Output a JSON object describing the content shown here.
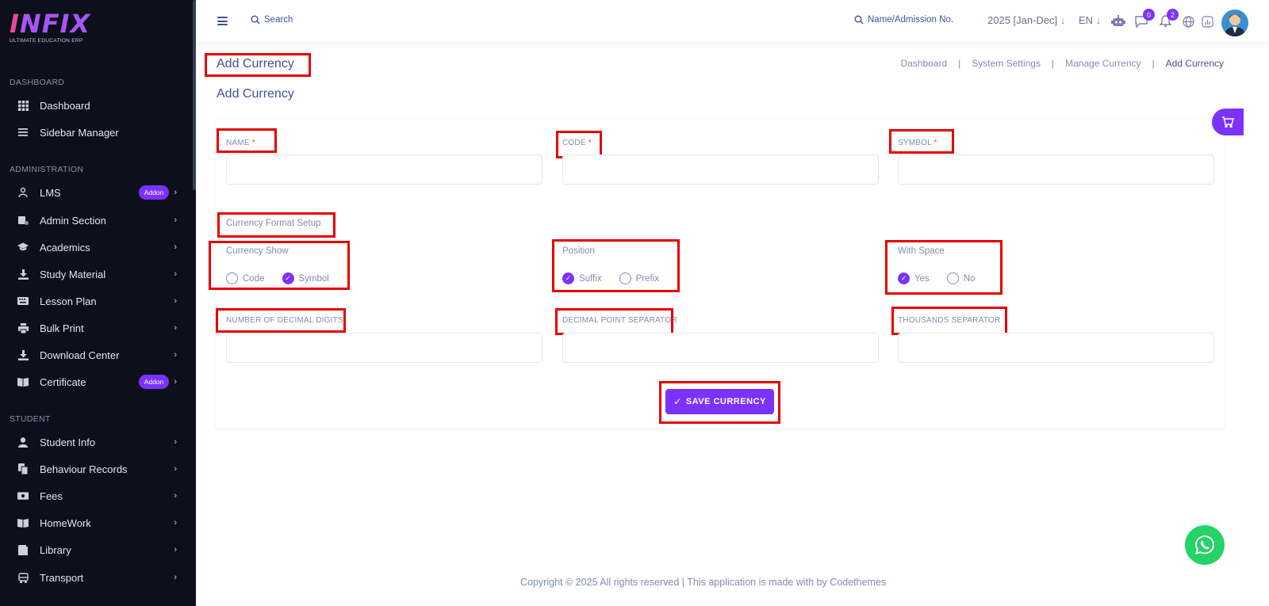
{
  "brand": {
    "logo": "INFIX",
    "tagline": "ULTIMATE EDUCATION ERP"
  },
  "sidebar": {
    "sections": [
      {
        "label": "DASHBOARD",
        "items": [
          {
            "label": "Dashboard",
            "icon": "grid-icon"
          },
          {
            "label": "Sidebar Manager",
            "icon": "list-icon"
          }
        ]
      },
      {
        "label": "ADMINISTRATION",
        "items": [
          {
            "label": "LMS",
            "icon": "lms-icon",
            "badge": "Addon"
          },
          {
            "label": "Admin Section",
            "icon": "admin-icon"
          },
          {
            "label": "Academics",
            "icon": "graduation-cap-icon"
          },
          {
            "label": "Study Material",
            "icon": "download-icon"
          },
          {
            "label": "Lesson Plan",
            "icon": "keyboard-icon"
          },
          {
            "label": "Bulk Print",
            "icon": "printer-icon"
          },
          {
            "label": "Download Center",
            "icon": "download-icon"
          },
          {
            "label": "Certificate",
            "icon": "book-icon",
            "badge": "Addon"
          }
        ]
      },
      {
        "label": "STUDENT",
        "items": [
          {
            "label": "Student Info",
            "icon": "user-icon"
          },
          {
            "label": "Behaviour Records",
            "icon": "records-icon"
          },
          {
            "label": "Fees",
            "icon": "money-icon"
          },
          {
            "label": "HomeWork",
            "icon": "book-icon"
          },
          {
            "label": "Library",
            "icon": "library-icon"
          },
          {
            "label": "Transport",
            "icon": "bus-icon"
          }
        ]
      }
    ]
  },
  "topbar": {
    "search_label": "Search",
    "name_search_label": "Name/Admission No.",
    "academic_year": "2025 [Jan-Dec]",
    "language": "EN",
    "chat_badge": "0",
    "notification_badge": "2"
  },
  "page": {
    "title": "Add Currency",
    "breadcrumb": [
      "Dashboard",
      "System Settings",
      "Manage Currency",
      "Add Currency"
    ],
    "card_title": "Add Currency"
  },
  "form": {
    "name_label": "NAME",
    "code_label": "CODE",
    "symbol_label": "SYMBOL",
    "required_mark": "*",
    "name_value": "",
    "code_value": "",
    "symbol_value": "",
    "format_setup_label": "Currency Format Setup",
    "currency_show": {
      "label": "Currency Show",
      "options": [
        "Code",
        "Symbol"
      ],
      "selected": "Symbol"
    },
    "position": {
      "label": "Position",
      "options": [
        "Suffix",
        "Prefix"
      ],
      "selected": "Suffix"
    },
    "with_space": {
      "label": "With Space",
      "options": [
        "Yes",
        "No"
      ],
      "selected": "Yes"
    },
    "decimal_digits_label": "NUMBER OF DECIMAL DIGITS",
    "decimal_separator_label": "DECIMAL POINT SEPARATOR",
    "thousands_separator_label": "THOUSANDS SEPARATOR",
    "decimal_digits_value": "",
    "decimal_separator_value": "",
    "thousands_separator_value": "",
    "save_label": "SAVE CURRENCY"
  },
  "footer": {
    "text": "Copyright © 2025 All rights reserved | This application is made with by Codethemes"
  },
  "colors": {
    "accent": "#7c32ff",
    "sidebar_bg": "#0d0f1b",
    "text": "#415094",
    "highlight": "#e60000",
    "whatsapp": "#25d366"
  }
}
